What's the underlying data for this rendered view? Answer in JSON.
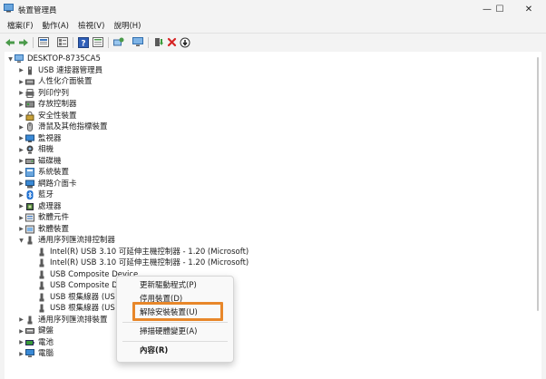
{
  "window": {
    "title": "裝置管理員",
    "minimize_glyph": "—",
    "maximize_glyph": "☐",
    "close_glyph": "✕"
  },
  "menubar": {
    "items": [
      {
        "label": "檔案(F)"
      },
      {
        "label": "動作(A)"
      },
      {
        "label": "檢視(V)"
      },
      {
        "label": "說明(H)"
      }
    ]
  },
  "toolbar": {
    "icons": [
      "back-icon",
      "forward-icon",
      "properties-icon",
      "tree-view-icon",
      "help-icon",
      "details-view-icon",
      "scan-hardware-icon",
      "monitor-icon",
      "update-driver-icon",
      "uninstall-icon",
      "disable-icon"
    ]
  },
  "tree": {
    "root": "DESKTOP-8735CA5",
    "categories": [
      {
        "label": "USB 連接器管理員",
        "icon": "usb-connector-icon"
      },
      {
        "label": "人性化介面裝置",
        "icon": "hid-icon"
      },
      {
        "label": "列印佇列",
        "icon": "printer-icon"
      },
      {
        "label": "存放控制器",
        "icon": "storage-icon"
      },
      {
        "label": "安全性裝置",
        "icon": "security-icon"
      },
      {
        "label": "滑鼠及其他指標裝置",
        "icon": "mouse-icon"
      },
      {
        "label": "監視器",
        "icon": "monitor-icon"
      },
      {
        "label": "相機",
        "icon": "camera-icon"
      },
      {
        "label": "磁碟機",
        "icon": "disk-icon"
      },
      {
        "label": "系統裝置",
        "icon": "system-icon"
      },
      {
        "label": "網路介面卡",
        "icon": "network-icon"
      },
      {
        "label": "藍牙",
        "icon": "bluetooth-icon"
      },
      {
        "label": "處理器",
        "icon": "processor-icon"
      },
      {
        "label": "軟體元件",
        "icon": "software-component-icon"
      },
      {
        "label": "軟體裝置",
        "icon": "software-device-icon"
      }
    ],
    "usb_controllers": {
      "label": "通用序列匯流排控制器",
      "children": [
        "Intel(R) USB 3.10 可延伸主機控制器 - 1.20 (Microsoft)",
        "Intel(R) USB 3.10 可延伸主機控制器 - 1.20 (Microsoft)",
        "USB Composite Device",
        "USB Composite D",
        "USB 根集線器 (US",
        "USB 根集線器 (US"
      ]
    },
    "after": [
      {
        "label": "通用序列匯流排裝置",
        "icon": "usb-device-icon"
      },
      {
        "label": "鍵盤",
        "icon": "keyboard-icon"
      },
      {
        "label": "電池",
        "icon": "battery-icon"
      },
      {
        "label": "電腦",
        "icon": "computer-icon"
      }
    ]
  },
  "context_menu": {
    "items": [
      {
        "label": "更新驅動程式(P)"
      },
      {
        "label": "停用裝置(D)"
      },
      {
        "label": "解除安裝裝置(U)"
      },
      {
        "label": "掃描硬體變更(A)"
      },
      {
        "label": "內容(R)"
      }
    ]
  },
  "colors": {
    "highlight": "#e8872a",
    "accent": "#1d6fd1"
  }
}
